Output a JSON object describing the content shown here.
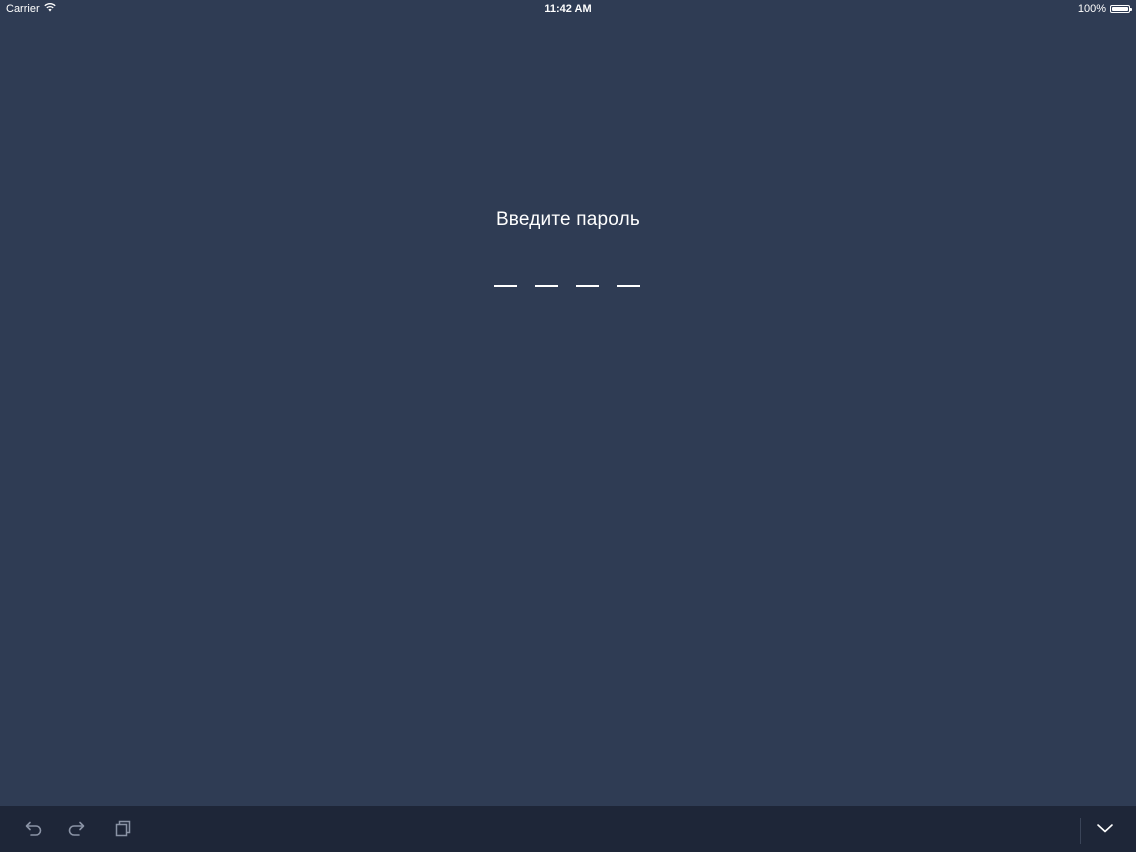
{
  "status_bar": {
    "carrier": "Carrier",
    "time": "11:42 AM",
    "battery": "100%",
    "battery_level": 1.0
  },
  "lock_screen": {
    "prompt": "Введите пароль",
    "pin_slots": 4,
    "pin_entered": 0
  },
  "toolbar": {
    "icons": [
      "undo-icon",
      "redo-icon",
      "clipboard-icon",
      "chevron-down-icon"
    ]
  },
  "colors": {
    "background": "#2f3c54",
    "toolbar": "#1e2638",
    "text": "#ffffff",
    "toolbar_icon": "#8a93a5"
  }
}
